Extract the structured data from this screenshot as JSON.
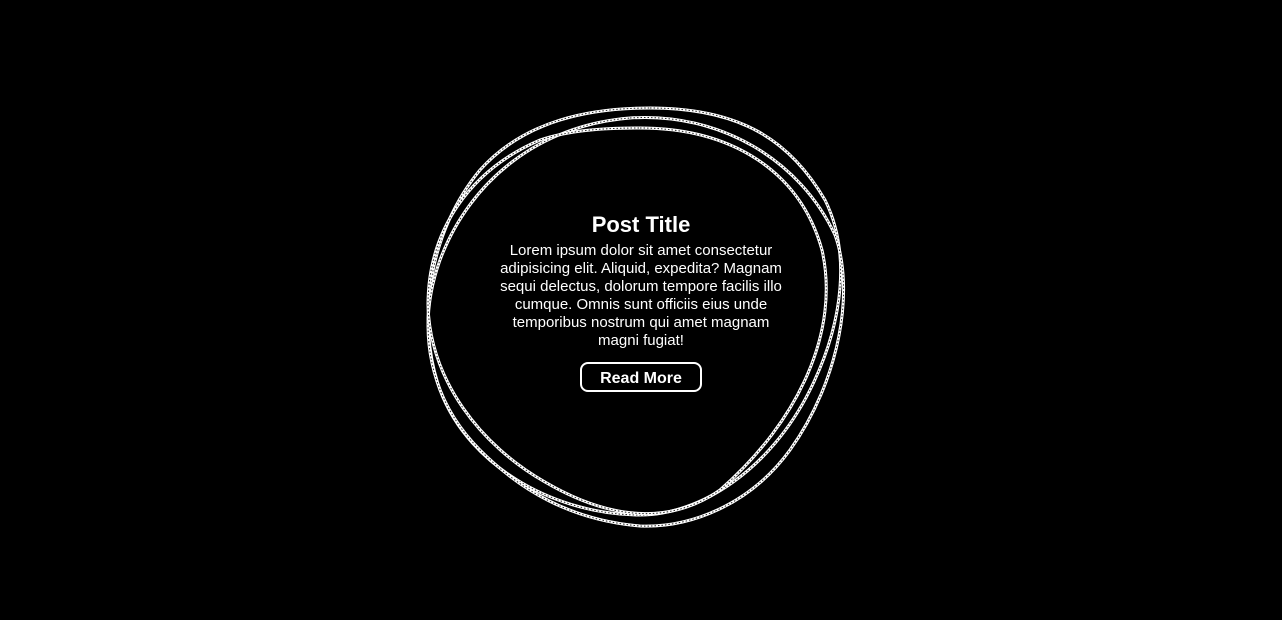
{
  "post": {
    "title": "Post Title",
    "body": "Lorem ipsum dolor sit amet consectetur adipisicing elit. Aliquid, expedita? Magnam sequi delectus, dolorum tempore facilis illo cumque. Omnis sunt officiis eius unde temporibus nostrum qui amet magnam magni fugiat!",
    "button_label": "Read More"
  },
  "colors": {
    "background": "#000000",
    "foreground": "#ffffff"
  }
}
